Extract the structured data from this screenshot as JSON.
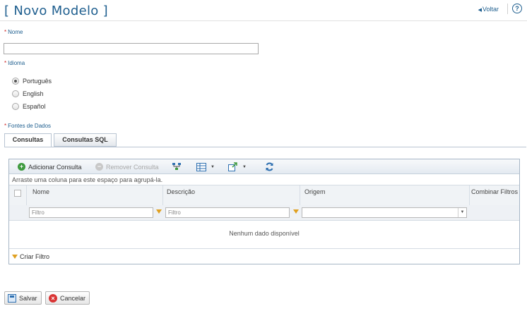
{
  "header": {
    "title": "[ Novo Modelo ]",
    "back_label": "Voltar",
    "help_symbol": "?"
  },
  "form": {
    "name_label": "Nome",
    "name_value": "",
    "language_label": "Idioma",
    "languages": [
      {
        "label": "Português",
        "checked": true
      },
      {
        "label": "English",
        "checked": false
      },
      {
        "label": "Español",
        "checked": false
      }
    ],
    "data_sources_label": "Fontes de Dados"
  },
  "tabs": [
    {
      "label": "Consultas",
      "active": true
    },
    {
      "label": "Consultas SQL",
      "active": false
    }
  ],
  "grid": {
    "toolbar": {
      "add_label": "Adicionar Consulta",
      "remove_label": "Remover Consulta"
    },
    "group_panel_text": "Arraste uma coluna para este espaço para agrupá-la.",
    "columns": [
      "Nome",
      "Descrição",
      "Origem",
      "Combinar Filtros"
    ],
    "filter_placeholder": "Filtro",
    "empty_message": "Nenhum dado disponível",
    "create_filter_label": "Criar Filtro"
  },
  "actions": {
    "save_label": "Salvar",
    "cancel_label": "Cancelar"
  },
  "colors": {
    "accent": "#1f5f8f",
    "required": "#cc2222",
    "add_icon": "#3e9a3e",
    "cancel_icon": "#d93434",
    "filter_icon": "#e0a020"
  }
}
